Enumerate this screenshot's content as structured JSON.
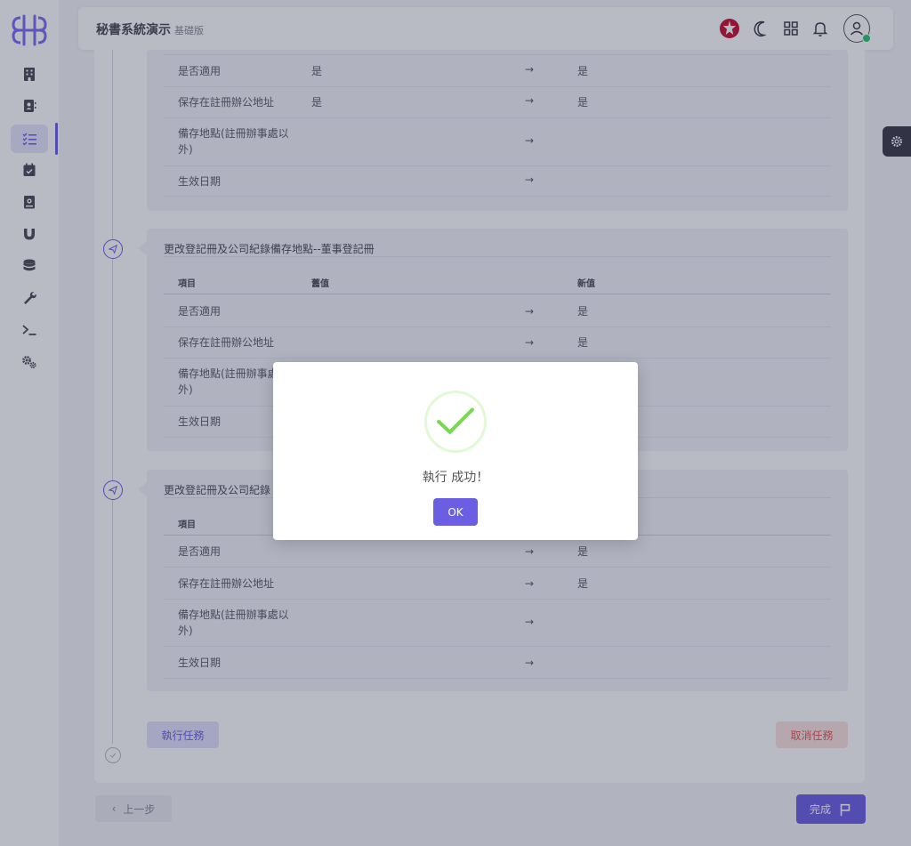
{
  "header": {
    "title": "秘書系統演示",
    "subtitle": "基礎版"
  },
  "sidebar": {
    "items": [
      {
        "icon": "building-icon"
      },
      {
        "icon": "contacts-icon"
      },
      {
        "icon": "task-list-icon",
        "active": true
      },
      {
        "icon": "calendar-icon"
      },
      {
        "icon": "book-icon"
      },
      {
        "icon": "magnet-icon"
      },
      {
        "icon": "database-icon"
      },
      {
        "icon": "wrench-icon"
      },
      {
        "icon": "terminal-icon"
      },
      {
        "icon": "cogs-icon"
      }
    ]
  },
  "section1": {
    "rows": [
      {
        "item": "是否適用",
        "old": "是",
        "new": "是"
      },
      {
        "item": "保存在註冊辦公地址",
        "old": "是",
        "new": "是"
      },
      {
        "item": "備存地點(註冊辦事處以外)",
        "old": "",
        "new": ""
      },
      {
        "item": "生效日期",
        "old": "",
        "new": ""
      }
    ]
  },
  "section2": {
    "title": "更改登記冊及公司紀錄備存地點--董事登記冊",
    "headers": {
      "item": "項目",
      "old": "舊值",
      "new": "新值"
    },
    "rows": [
      {
        "item": "是否適用",
        "new": "是"
      },
      {
        "item": "保存在註冊辦公地址",
        "new": "是"
      },
      {
        "item": "備存地點(註冊辦事處以外)",
        "new": ""
      },
      {
        "item": "生效日期",
        "new": ""
      }
    ]
  },
  "section3": {
    "title": "更改登記冊及公司紀錄",
    "headers": {
      "item": "項目"
    },
    "rows": [
      {
        "item": "是否適用",
        "new": "是"
      },
      {
        "item": "保存在註冊辦公地址",
        "new": "是"
      },
      {
        "item": "備存地點(註冊辦事處以外)",
        "new": ""
      },
      {
        "item": "生效日期",
        "new": ""
      }
    ]
  },
  "arrow_glyph": "→",
  "buttons": {
    "execute": "執行任務",
    "cancel": "取消任務",
    "previous": "上一步",
    "finish": "完成"
  },
  "modal": {
    "message": "執行 成功！",
    "ok": "OK"
  },
  "colors": {
    "primary": "#6a5fe3",
    "danger": "#ea5455",
    "success": "#28c76f",
    "check": "#7ad84f"
  }
}
